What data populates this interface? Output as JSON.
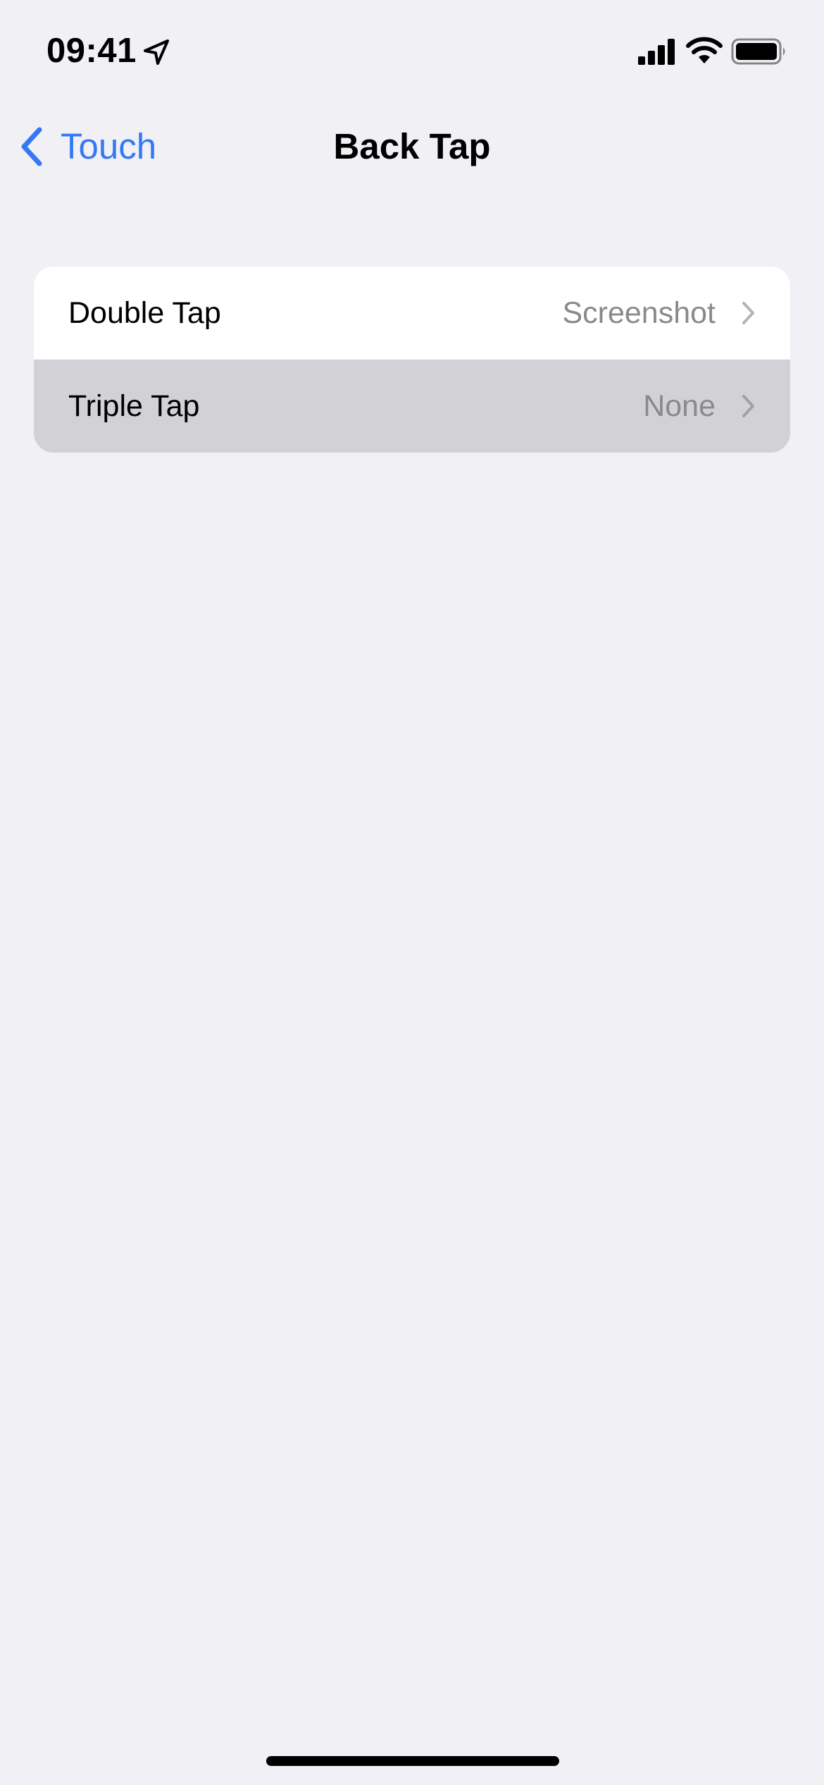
{
  "status_bar": {
    "time": "09:41",
    "icons": [
      "location-arrow-icon",
      "cellular-signal-icon",
      "wifi-icon",
      "battery-icon"
    ]
  },
  "nav": {
    "back_label": "Touch",
    "title": "Back Tap"
  },
  "settings": {
    "rows": [
      {
        "label": "Double Tap",
        "value": "Screenshot",
        "highlighted": false
      },
      {
        "label": "Triple Tap",
        "value": "None",
        "highlighted": true
      }
    ]
  },
  "colors": {
    "background": "#f0f0f5",
    "accent": "#3478f6",
    "secondary_text": "#8a8a8e",
    "row_highlight": "#d1d1d6"
  }
}
